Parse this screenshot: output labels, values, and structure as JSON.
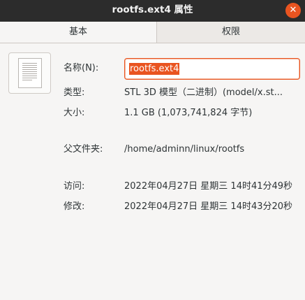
{
  "window": {
    "title": "rootfs.ext4 属性",
    "close_glyph": "✕"
  },
  "tabs": [
    {
      "label": "基本",
      "active": true
    },
    {
      "label": "权限",
      "active": false
    }
  ],
  "icon": {
    "name": "text-file-icon"
  },
  "fields": {
    "name_label": "名称(N):",
    "name_value": "rootfs.ext4",
    "type_label": "类型:",
    "type_value": "STL 3D 模型（二进制）(model/x.st...",
    "size_label": "大小:",
    "size_value": "1.1 GB (1,073,741,824 字节)",
    "parent_label": "父文件夹:",
    "parent_value": "/home/adminn/linux/rootfs",
    "accessed_label": "访问:",
    "accessed_value": "2022年04月27日 星期三 14时41分49秒",
    "modified_label": "修改:",
    "modified_value": "2022年04月27日 星期三 14时43分20秒"
  },
  "colors": {
    "accent": "#e95420",
    "titlebar": "#2c2c2c",
    "background": "#f6f5f4"
  }
}
